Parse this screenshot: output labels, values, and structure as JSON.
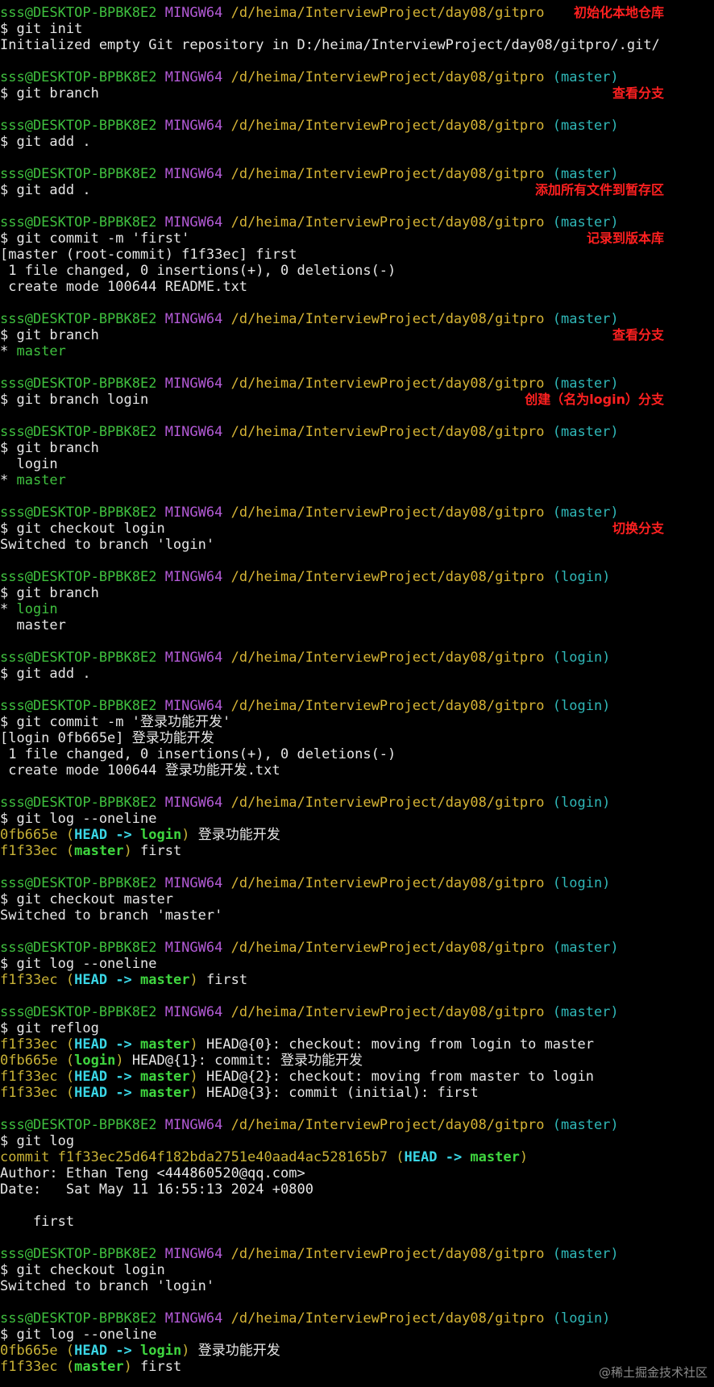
{
  "colors": {
    "user": "#3fc03f",
    "host": "#b35ad6",
    "path": "#d6b435",
    "branch": "#2fb7b7",
    "annotation": "#ff2020",
    "background": "#000000"
  },
  "lines": [
    {
      "segments": [
        {
          "t": "sss@DESKTOP-BPBK8E2 ",
          "c": "user"
        },
        {
          "t": "MINGW64 ",
          "c": "host"
        },
        {
          "t": "/d/heima/InterviewProject/day08/gitpro",
          "c": "path"
        }
      ],
      "note": "初始化本地仓库"
    },
    {
      "segments": [
        {
          "t": "$ git init",
          "c": "white"
        }
      ]
    },
    {
      "segments": [
        {
          "t": "Initialized empty Git repository in D:/heima/InterviewProject/day08/gitpro/.git/",
          "c": "white"
        }
      ]
    },
    {
      "segments": []
    },
    {
      "segments": [
        {
          "t": "sss@DESKTOP-BPBK8E2 ",
          "c": "user"
        },
        {
          "t": "MINGW64 ",
          "c": "host"
        },
        {
          "t": "/d/heima/InterviewProject/day08/gitpro ",
          "c": "path"
        },
        {
          "t": "(master)",
          "c": "branch"
        }
      ]
    },
    {
      "segments": [
        {
          "t": "$ git branch",
          "c": "white"
        }
      ],
      "note": "查看分支"
    },
    {
      "segments": []
    },
    {
      "segments": [
        {
          "t": "sss@DESKTOP-BPBK8E2 ",
          "c": "user"
        },
        {
          "t": "MINGW64 ",
          "c": "host"
        },
        {
          "t": "/d/heima/InterviewProject/day08/gitpro ",
          "c": "path"
        },
        {
          "t": "(master)",
          "c": "branch"
        }
      ]
    },
    {
      "segments": [
        {
          "t": "$ git add .",
          "c": "white"
        }
      ]
    },
    {
      "segments": []
    },
    {
      "segments": [
        {
          "t": "sss@DESKTOP-BPBK8E2 ",
          "c": "user"
        },
        {
          "t": "MINGW64 ",
          "c": "host"
        },
        {
          "t": "/d/heima/InterviewProject/day08/gitpro ",
          "c": "path"
        },
        {
          "t": "(master)",
          "c": "branch"
        }
      ]
    },
    {
      "segments": [
        {
          "t": "$ git add .",
          "c": "white"
        }
      ],
      "note": "添加所有文件到暂存区"
    },
    {
      "segments": []
    },
    {
      "segments": [
        {
          "t": "sss@DESKTOP-BPBK8E2 ",
          "c": "user"
        },
        {
          "t": "MINGW64 ",
          "c": "host"
        },
        {
          "t": "/d/heima/InterviewProject/day08/gitpro ",
          "c": "path"
        },
        {
          "t": "(master)",
          "c": "branch"
        }
      ]
    },
    {
      "segments": [
        {
          "t": "$ git commit -m 'first'",
          "c": "white"
        }
      ],
      "note": "记录到版本库"
    },
    {
      "segments": [
        {
          "t": "[master (root-commit) f1f33ec] first",
          "c": "white"
        }
      ]
    },
    {
      "segments": [
        {
          "t": " 1 file changed, 0 insertions(+), 0 deletions(-)",
          "c": "white"
        }
      ]
    },
    {
      "segments": [
        {
          "t": " create mode 100644 README.txt",
          "c": "white"
        }
      ]
    },
    {
      "segments": []
    },
    {
      "segments": [
        {
          "t": "sss@DESKTOP-BPBK8E2 ",
          "c": "user"
        },
        {
          "t": "MINGW64 ",
          "c": "host"
        },
        {
          "t": "/d/heima/InterviewProject/day08/gitpro ",
          "c": "path"
        },
        {
          "t": "(master)",
          "c": "branch"
        }
      ]
    },
    {
      "segments": [
        {
          "t": "$ git branch",
          "c": "white"
        }
      ],
      "note": "查看分支"
    },
    {
      "segments": [
        {
          "t": "* ",
          "c": "white"
        },
        {
          "t": "master",
          "c": "green"
        }
      ]
    },
    {
      "segments": []
    },
    {
      "segments": [
        {
          "t": "sss@DESKTOP-BPBK8E2 ",
          "c": "user"
        },
        {
          "t": "MINGW64 ",
          "c": "host"
        },
        {
          "t": "/d/heima/InterviewProject/day08/gitpro ",
          "c": "path"
        },
        {
          "t": "(master)",
          "c": "branch"
        }
      ]
    },
    {
      "segments": [
        {
          "t": "$ git branch login",
          "c": "white"
        }
      ],
      "note": "创建（名为login）分支"
    },
    {
      "segments": []
    },
    {
      "segments": [
        {
          "t": "sss@DESKTOP-BPBK8E2 ",
          "c": "user"
        },
        {
          "t": "MINGW64 ",
          "c": "host"
        },
        {
          "t": "/d/heima/InterviewProject/day08/gitpro ",
          "c": "path"
        },
        {
          "t": "(master)",
          "c": "branch"
        }
      ]
    },
    {
      "segments": [
        {
          "t": "$ git branch",
          "c": "white"
        }
      ]
    },
    {
      "segments": [
        {
          "t": "  login",
          "c": "white"
        }
      ]
    },
    {
      "segments": [
        {
          "t": "* ",
          "c": "white"
        },
        {
          "t": "master",
          "c": "green"
        }
      ]
    },
    {
      "segments": []
    },
    {
      "segments": [
        {
          "t": "sss@DESKTOP-BPBK8E2 ",
          "c": "user"
        },
        {
          "t": "MINGW64 ",
          "c": "host"
        },
        {
          "t": "/d/heima/InterviewProject/day08/gitpro ",
          "c": "path"
        },
        {
          "t": "(master)",
          "c": "branch"
        }
      ]
    },
    {
      "segments": [
        {
          "t": "$ git checkout login",
          "c": "white"
        }
      ],
      "note": "切换分支"
    },
    {
      "segments": [
        {
          "t": "Switched to branch 'login'",
          "c": "white"
        }
      ]
    },
    {
      "segments": []
    },
    {
      "segments": [
        {
          "t": "sss@DESKTOP-BPBK8E2 ",
          "c": "user"
        },
        {
          "t": "MINGW64 ",
          "c": "host"
        },
        {
          "t": "/d/heima/InterviewProject/day08/gitpro ",
          "c": "path"
        },
        {
          "t": "(login)",
          "c": "branch"
        }
      ]
    },
    {
      "segments": [
        {
          "t": "$ git branch",
          "c": "white"
        }
      ]
    },
    {
      "segments": [
        {
          "t": "* ",
          "c": "white"
        },
        {
          "t": "login",
          "c": "green"
        }
      ]
    },
    {
      "segments": [
        {
          "t": "  master",
          "c": "white"
        }
      ]
    },
    {
      "segments": []
    },
    {
      "segments": [
        {
          "t": "sss@DESKTOP-BPBK8E2 ",
          "c": "user"
        },
        {
          "t": "MINGW64 ",
          "c": "host"
        },
        {
          "t": "/d/heima/InterviewProject/day08/gitpro ",
          "c": "path"
        },
        {
          "t": "(login)",
          "c": "branch"
        }
      ]
    },
    {
      "segments": [
        {
          "t": "$ git add .",
          "c": "white"
        }
      ]
    },
    {
      "segments": []
    },
    {
      "segments": [
        {
          "t": "sss@DESKTOP-BPBK8E2 ",
          "c": "user"
        },
        {
          "t": "MINGW64 ",
          "c": "host"
        },
        {
          "t": "/d/heima/InterviewProject/day08/gitpro ",
          "c": "path"
        },
        {
          "t": "(login)",
          "c": "branch"
        }
      ]
    },
    {
      "segments": [
        {
          "t": "$ git commit -m '登录功能开发'",
          "c": "white"
        }
      ]
    },
    {
      "segments": [
        {
          "t": "[login 0fb665e] 登录功能开发",
          "c": "white"
        }
      ]
    },
    {
      "segments": [
        {
          "t": " 1 file changed, 0 insertions(+), 0 deletions(-)",
          "c": "white"
        }
      ]
    },
    {
      "segments": [
        {
          "t": " create mode 100644 登录功能开发.txt",
          "c": "white"
        }
      ]
    },
    {
      "segments": []
    },
    {
      "segments": [
        {
          "t": "sss@DESKTOP-BPBK8E2 ",
          "c": "user"
        },
        {
          "t": "MINGW64 ",
          "c": "host"
        },
        {
          "t": "/d/heima/InterviewProject/day08/gitpro ",
          "c": "path"
        },
        {
          "t": "(login)",
          "c": "branch"
        }
      ]
    },
    {
      "segments": [
        {
          "t": "$ git log --oneline",
          "c": "white"
        }
      ]
    },
    {
      "segments": [
        {
          "t": "0fb665e ",
          "c": "yellow"
        },
        {
          "t": "(",
          "c": "yellow"
        },
        {
          "t": "HEAD -> ",
          "c": "cyanb"
        },
        {
          "t": "login",
          "c": "greenb"
        },
        {
          "t": ")",
          "c": "yellow"
        },
        {
          "t": " 登录功能开发",
          "c": "white"
        }
      ]
    },
    {
      "segments": [
        {
          "t": "f1f33ec ",
          "c": "yellow"
        },
        {
          "t": "(",
          "c": "yellow"
        },
        {
          "t": "master",
          "c": "greenb"
        },
        {
          "t": ")",
          "c": "yellow"
        },
        {
          "t": " first",
          "c": "white"
        }
      ]
    },
    {
      "segments": []
    },
    {
      "segments": [
        {
          "t": "sss@DESKTOP-BPBK8E2 ",
          "c": "user"
        },
        {
          "t": "MINGW64 ",
          "c": "host"
        },
        {
          "t": "/d/heima/InterviewProject/day08/gitpro ",
          "c": "path"
        },
        {
          "t": "(login)",
          "c": "branch"
        }
      ]
    },
    {
      "segments": [
        {
          "t": "$ git checkout master",
          "c": "white"
        }
      ]
    },
    {
      "segments": [
        {
          "t": "Switched to branch 'master'",
          "c": "white"
        }
      ]
    },
    {
      "segments": []
    },
    {
      "segments": [
        {
          "t": "sss@DESKTOP-BPBK8E2 ",
          "c": "user"
        },
        {
          "t": "MINGW64 ",
          "c": "host"
        },
        {
          "t": "/d/heima/InterviewProject/day08/gitpro ",
          "c": "path"
        },
        {
          "t": "(master)",
          "c": "branch"
        }
      ]
    },
    {
      "segments": [
        {
          "t": "$ git log --oneline",
          "c": "white"
        }
      ]
    },
    {
      "segments": [
        {
          "t": "f1f33ec ",
          "c": "yellow"
        },
        {
          "t": "(",
          "c": "yellow"
        },
        {
          "t": "HEAD -> ",
          "c": "cyanb"
        },
        {
          "t": "master",
          "c": "greenb"
        },
        {
          "t": ")",
          "c": "yellow"
        },
        {
          "t": " first",
          "c": "white"
        }
      ]
    },
    {
      "segments": []
    },
    {
      "segments": [
        {
          "t": "sss@DESKTOP-BPBK8E2 ",
          "c": "user"
        },
        {
          "t": "MINGW64 ",
          "c": "host"
        },
        {
          "t": "/d/heima/InterviewProject/day08/gitpro ",
          "c": "path"
        },
        {
          "t": "(master)",
          "c": "branch"
        }
      ]
    },
    {
      "segments": [
        {
          "t": "$ git reflog",
          "c": "white"
        }
      ]
    },
    {
      "segments": [
        {
          "t": "f1f33ec ",
          "c": "yellow"
        },
        {
          "t": "(",
          "c": "yellow"
        },
        {
          "t": "HEAD -> ",
          "c": "cyanb"
        },
        {
          "t": "master",
          "c": "greenb"
        },
        {
          "t": ")",
          "c": "yellow"
        },
        {
          "t": " HEAD@{0}: checkout: moving from login to master",
          "c": "white"
        }
      ]
    },
    {
      "segments": [
        {
          "t": "0fb665e ",
          "c": "yellow"
        },
        {
          "t": "(",
          "c": "yellow"
        },
        {
          "t": "login",
          "c": "greenb"
        },
        {
          "t": ")",
          "c": "yellow"
        },
        {
          "t": " HEAD@{1}: commit: 登录功能开发",
          "c": "white"
        }
      ]
    },
    {
      "segments": [
        {
          "t": "f1f33ec ",
          "c": "yellow"
        },
        {
          "t": "(",
          "c": "yellow"
        },
        {
          "t": "HEAD -> ",
          "c": "cyanb"
        },
        {
          "t": "master",
          "c": "greenb"
        },
        {
          "t": ")",
          "c": "yellow"
        },
        {
          "t": " HEAD@{2}: checkout: moving from master to login",
          "c": "white"
        }
      ]
    },
    {
      "segments": [
        {
          "t": "f1f33ec ",
          "c": "yellow"
        },
        {
          "t": "(",
          "c": "yellow"
        },
        {
          "t": "HEAD -> ",
          "c": "cyanb"
        },
        {
          "t": "master",
          "c": "greenb"
        },
        {
          "t": ")",
          "c": "yellow"
        },
        {
          "t": " HEAD@{3}: commit (initial): first",
          "c": "white"
        }
      ]
    },
    {
      "segments": []
    },
    {
      "segments": [
        {
          "t": "sss@DESKTOP-BPBK8E2 ",
          "c": "user"
        },
        {
          "t": "MINGW64 ",
          "c": "host"
        },
        {
          "t": "/d/heima/InterviewProject/day08/gitpro ",
          "c": "path"
        },
        {
          "t": "(master)",
          "c": "branch"
        }
      ]
    },
    {
      "segments": [
        {
          "t": "$ git log",
          "c": "white"
        }
      ]
    },
    {
      "segments": [
        {
          "t": "commit f1f33ec25d64f182bda2751e40aad4ac528165b7 ",
          "c": "yellow"
        },
        {
          "t": "(",
          "c": "yellow"
        },
        {
          "t": "HEAD -> ",
          "c": "cyanb"
        },
        {
          "t": "master",
          "c": "greenb"
        },
        {
          "t": ")",
          "c": "yellow"
        }
      ]
    },
    {
      "segments": [
        {
          "t": "Author: Ethan Teng <444860520@qq.com>",
          "c": "white"
        }
      ]
    },
    {
      "segments": [
        {
          "t": "Date:   Sat May 11 16:55:13 2024 +0800",
          "c": "white"
        }
      ]
    },
    {
      "segments": []
    },
    {
      "segments": [
        {
          "t": "    first",
          "c": "white"
        }
      ]
    },
    {
      "segments": []
    },
    {
      "segments": [
        {
          "t": "sss@DESKTOP-BPBK8E2 ",
          "c": "user"
        },
        {
          "t": "MINGW64 ",
          "c": "host"
        },
        {
          "t": "/d/heima/InterviewProject/day08/gitpro ",
          "c": "path"
        },
        {
          "t": "(master)",
          "c": "branch"
        }
      ]
    },
    {
      "segments": [
        {
          "t": "$ git checkout login",
          "c": "white"
        }
      ]
    },
    {
      "segments": [
        {
          "t": "Switched to branch 'login'",
          "c": "white"
        }
      ]
    },
    {
      "segments": []
    },
    {
      "segments": [
        {
          "t": "sss@DESKTOP-BPBK8E2 ",
          "c": "user"
        },
        {
          "t": "MINGW64 ",
          "c": "host"
        },
        {
          "t": "/d/heima/InterviewProject/day08/gitpro ",
          "c": "path"
        },
        {
          "t": "(login)",
          "c": "branch"
        }
      ]
    },
    {
      "segments": [
        {
          "t": "$ git log --oneline",
          "c": "white"
        }
      ]
    },
    {
      "segments": [
        {
          "t": "0fb665e ",
          "c": "yellow"
        },
        {
          "t": "(",
          "c": "yellow"
        },
        {
          "t": "HEAD -> ",
          "c": "cyanb"
        },
        {
          "t": "login",
          "c": "greenb"
        },
        {
          "t": ")",
          "c": "yellow"
        },
        {
          "t": " 登录功能开发",
          "c": "white"
        }
      ]
    },
    {
      "segments": [
        {
          "t": "f1f33ec ",
          "c": "yellow"
        },
        {
          "t": "(",
          "c": "yellow"
        },
        {
          "t": "master",
          "c": "greenb"
        },
        {
          "t": ")",
          "c": "yellow"
        },
        {
          "t": " first",
          "c": "white"
        }
      ]
    }
  ],
  "watermark": "@稀土掘金技术社区"
}
